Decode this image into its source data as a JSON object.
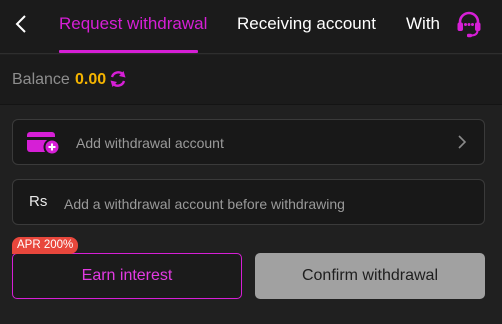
{
  "header": {
    "tabs": [
      {
        "label": "Request withdrawal",
        "active": true
      },
      {
        "label": "Receiving account",
        "active": false
      },
      {
        "label": "With",
        "active": false
      }
    ],
    "icons": {
      "back": "chevron-left-icon",
      "support": "headset-icon"
    }
  },
  "balance": {
    "label": "Balance",
    "value": "0.00",
    "refresh_icon": "refresh-icon"
  },
  "account_card": {
    "icon": "wallet-add-icon",
    "text": "Add withdrawal account",
    "arrow_icon": "chevron-right-icon"
  },
  "amount_field": {
    "currency_symbol": "Rs",
    "placeholder": "Add a withdrawal account before withdrawing"
  },
  "actions": {
    "apr_badge": "APR 200%",
    "earn_label": "Earn interest",
    "confirm_label": "Confirm withdrawal"
  },
  "colors": {
    "accent": "#d61fd6",
    "balance": "#f5b400",
    "badge": "#e8473c",
    "background": "#202020",
    "disabled_button": "#a1a1a1"
  }
}
